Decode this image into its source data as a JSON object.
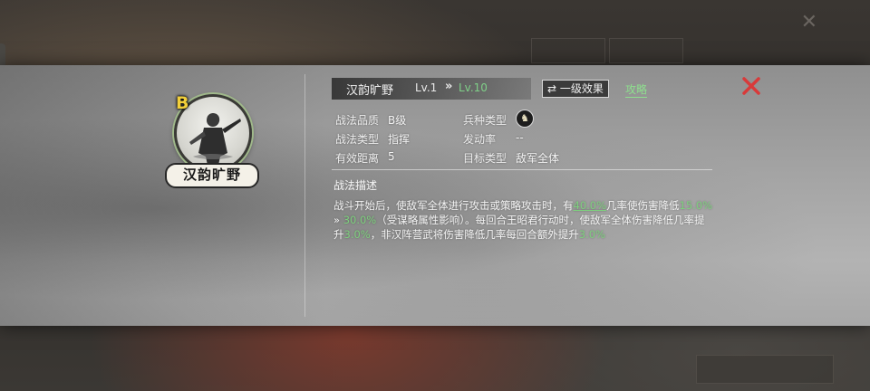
{
  "skill": {
    "name": "汉韵旷野",
    "level_current": "Lv.1",
    "level_arrow": "»",
    "level_max": "Lv.10",
    "grade_badge": "B",
    "portrait_label": "汉韵旷野"
  },
  "buttons": {
    "effect_icon": "⇄",
    "effect_label": "一级效果",
    "strategy_label": "攻略"
  },
  "attributes": {
    "quality_label": "战法品质",
    "quality_value": "B级",
    "type_label": "战法类型",
    "type_value": "指挥",
    "range_label": "有效距离",
    "range_value": "5",
    "troop_label": "兵种类型",
    "troop_icon": "horse-icon",
    "rate_label": "发动率",
    "rate_value": "--",
    "target_label": "目标类型",
    "target_value": "敌军全体"
  },
  "description": {
    "title": "战法描述",
    "seg1": "战斗开始后，使敌军全体进行攻击或策略攻击时，有",
    "pct1": "40.0%",
    "seg2": "几率使伤害降低",
    "pct2": "15.0%",
    "arrow": " » ",
    "pct3": "30.0%",
    "seg3": "（受谋略属性影响）。每回合王昭君行动时，使敌军全体伤害降低几率提升",
    "pct4": "3.0%",
    "seg4": "，非汉阵营武将伤害降低几率每回合额外提升",
    "pct5": "3.0%"
  },
  "colors": {
    "highlight_green": "#7ed07e",
    "close_red": "#d83a3a",
    "grade_yellow": "#f2cf3a"
  }
}
